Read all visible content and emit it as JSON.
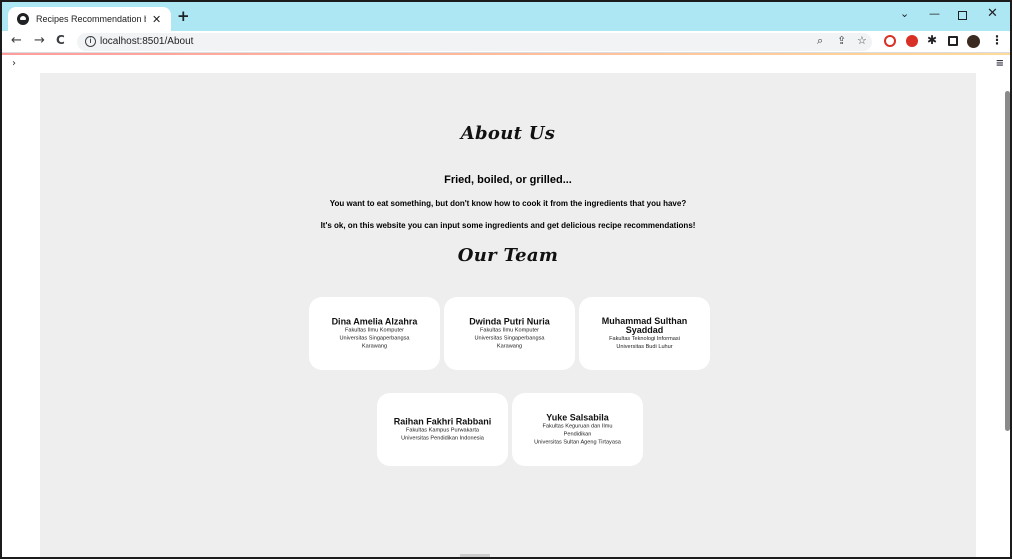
{
  "browser": {
    "tab_title": "Recipes Recommendation by Epi",
    "new_tab_label": "+",
    "url": "localhost:8501/About",
    "icons": {
      "favicon": "streamlit-logo-icon",
      "back": "arrow-left-icon",
      "forward": "arrow-right-icon",
      "reload": "reload-icon",
      "info": "info-icon",
      "zoom": "zoom-icon",
      "share": "share-icon",
      "bookmark": "star-icon",
      "extensions": "puzzle-icon",
      "side_panel": "side-panel-icon",
      "profile": "profile-avatar-icon",
      "menu": "kebab-menu-icon"
    }
  },
  "app": {
    "sidebar_toggle": "›",
    "main_menu": "≡",
    "about_title": "About Us",
    "tagline": "Fried, boiled, or grilled...",
    "question": "You want to eat something, but don't know how to cook it from the ingredients that you have?",
    "answer": "It's ok, on this website you can input some ingredients and get delicious recipe recommendations!",
    "team_title": "Our Team",
    "team": [
      {
        "name": "Dina Amelia Alzahra",
        "lines": [
          "Fakultas Ilmu Komputer",
          "Universitas Singaperbangsa",
          "Karawang"
        ]
      },
      {
        "name": "Dwinda Putri Nuria",
        "lines": [
          "Fakultas Ilmu Komputer",
          "Universitas Singaperbangsa",
          "Karawang"
        ]
      },
      {
        "name": "Muhammad Sulthan Syaddad",
        "lines": [
          "Fakultas Teknologi Informasi",
          "Universitas Budi Luhur"
        ]
      },
      {
        "name": "Raihan Fakhri Rabbani",
        "lines": [
          "Fakultas Kampus Purwakarta",
          "Universitas Pendidikan Indonesia"
        ]
      },
      {
        "name": "Yuke Salsabila",
        "lines": [
          "Fakultas Keguruan dan Ilmu",
          "Pendidikan",
          "Universitas Sultan Ageng Tirtayasa"
        ]
      }
    ]
  },
  "colors": {
    "tab_strip": "#aee7f4",
    "content_bg": "#eeeeee",
    "card_bg": "#ffffff",
    "extension_red": "#d93025"
  }
}
